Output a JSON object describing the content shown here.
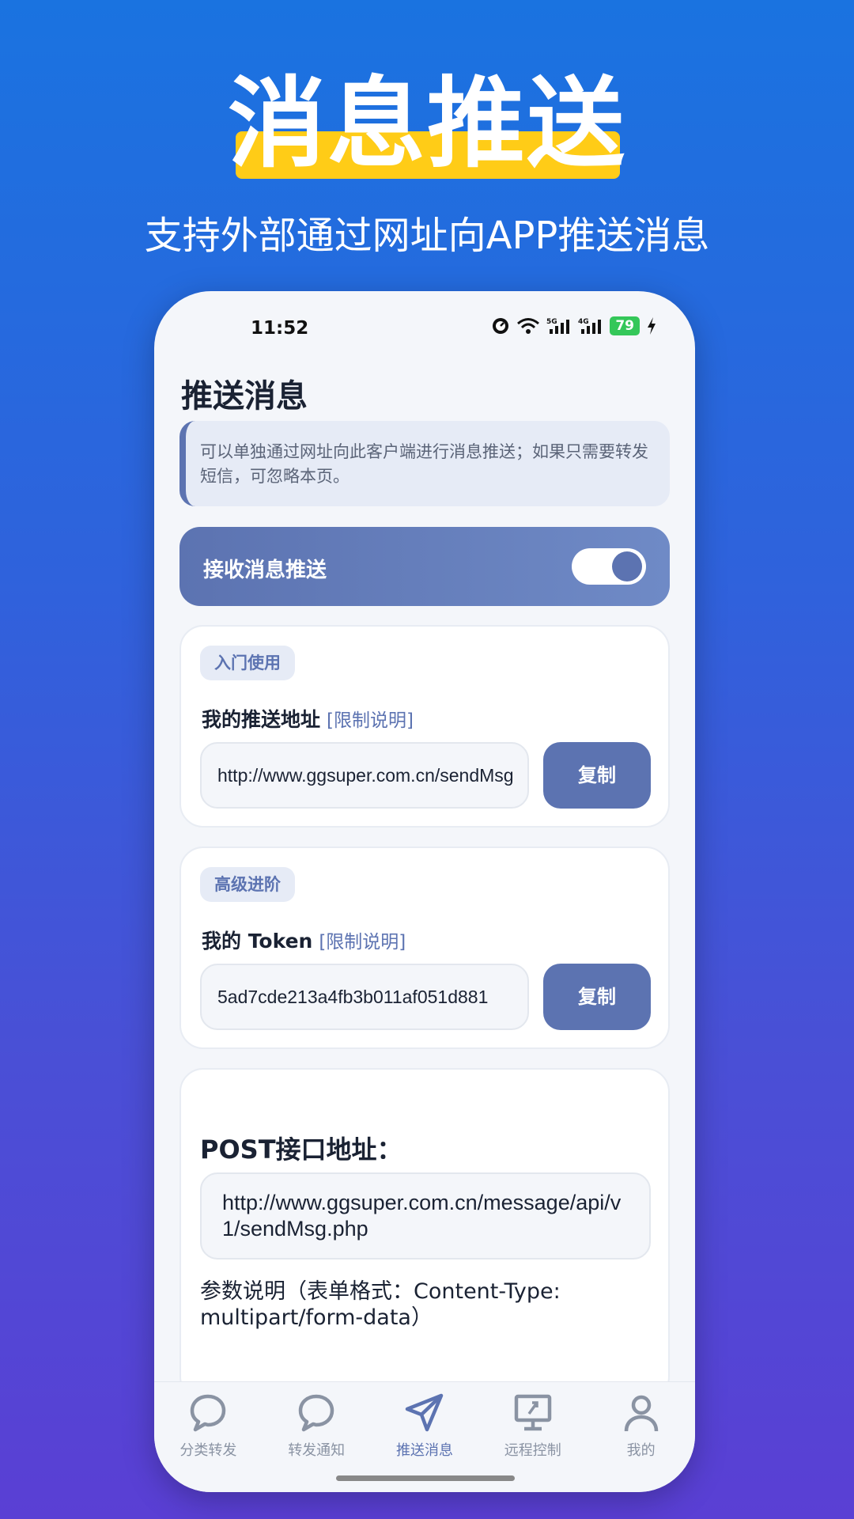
{
  "promo": {
    "title": "消息推送",
    "subtitle": "支持外部通过网址向APP推送消息",
    "highlight_color": "#ffcc17"
  },
  "statusbar": {
    "time": "11:52",
    "network_1": "5G",
    "network_2": "4G",
    "battery": "79"
  },
  "page": {
    "title": "推送消息",
    "notice": "可以单独通过网址向此客户端进行消息推送；如果只需要转发短信，可忽略本页。"
  },
  "toggle": {
    "label": "接收消息推送",
    "enabled": true
  },
  "basic": {
    "tag": "入门使用",
    "label": "我的推送地址",
    "help_link": "[限制说明]",
    "value": "http://www.ggsuper.com.cn/sendMsg",
    "copy_label": "复制"
  },
  "advanced": {
    "tag": "高级进阶",
    "label": "我的 Token",
    "help_link": "[限制说明]",
    "value": "5ad7cde213a4fb3b011af051d881",
    "copy_label": "复制"
  },
  "post": {
    "title": "POST接口地址：",
    "url": "http://www.ggsuper.com.cn/message/api/v1/sendMsg.php",
    "param_desc": "参数说明（表单格式：Content-Type: multipart/form-data）"
  },
  "tabbar": {
    "items": [
      {
        "label": "分类转发",
        "icon": "chat-bubble-icon",
        "active": false
      },
      {
        "label": "转发通知",
        "icon": "chat-bubble-icon",
        "active": false
      },
      {
        "label": "推送消息",
        "icon": "paper-plane-icon",
        "active": true
      },
      {
        "label": "远程控制",
        "icon": "remote-monitor-icon",
        "active": false
      },
      {
        "label": "我的",
        "icon": "user-icon",
        "active": false
      }
    ]
  },
  "colors": {
    "accent": "#5c73b1",
    "background_top": "#1a73e0",
    "background_bottom": "#5a3fd4"
  }
}
